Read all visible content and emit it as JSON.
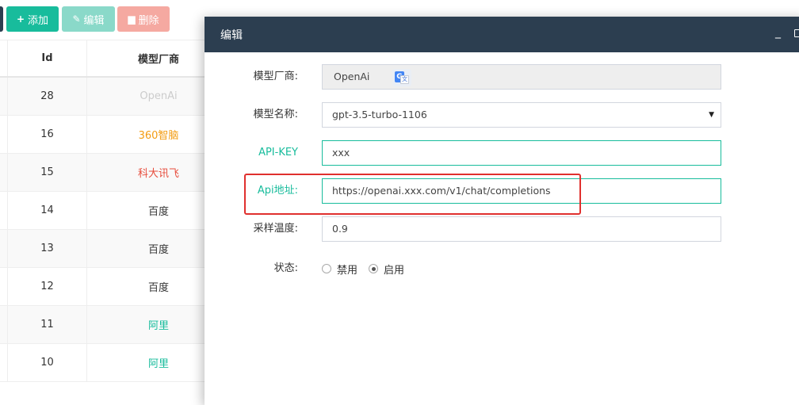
{
  "toolbar": {
    "add_label": "添加",
    "edit_label": "编辑",
    "delete_label": "删除"
  },
  "table": {
    "columns": [
      "Id",
      "模型厂商"
    ],
    "rows": [
      {
        "id": "28",
        "vendor": "OpenAi",
        "vendor_color": "#cccccc"
      },
      {
        "id": "16",
        "vendor": "360智脑",
        "vendor_color": "#f39c12"
      },
      {
        "id": "15",
        "vendor": "科大讯飞",
        "vendor_color": "#e74c3c"
      },
      {
        "id": "14",
        "vendor": "百度",
        "vendor_color": "#333333"
      },
      {
        "id": "13",
        "vendor": "百度",
        "vendor_color": "#333333"
      },
      {
        "id": "12",
        "vendor": "百度",
        "vendor_color": "#333333"
      },
      {
        "id": "11",
        "vendor": "阿里",
        "vendor_color": "#18bc9c"
      },
      {
        "id": "10",
        "vendor": "阿里",
        "vendor_color": "#18bc9c"
      }
    ]
  },
  "modal": {
    "title": "编辑",
    "minimize_symbol": "_",
    "fields": {
      "vendor_label": "模型厂商:",
      "vendor_value": "OpenAi",
      "model_label": "模型名称:",
      "model_value": "gpt-3.5-turbo-1106",
      "api_key_label": "API-KEY",
      "api_key_value": "xxx",
      "api_url_label": "Api地址:",
      "api_url_value": "https://openai.xxx.com/v1/chat/completions",
      "temperature_label": "采样温度:",
      "temperature_value": "0.9",
      "status_label": "状态:",
      "status_options": [
        "禁用",
        "启用"
      ],
      "status_selected": "启用"
    }
  },
  "colors": {
    "header_bg": "#2c3e50",
    "accent": "#18bc9c",
    "danger": "#e0302e"
  },
  "icons": [
    "plus-icon",
    "pencil-icon",
    "trash-icon",
    "translate-icon",
    "caret-down-icon",
    "minimize-icon",
    "maximize-icon"
  ]
}
